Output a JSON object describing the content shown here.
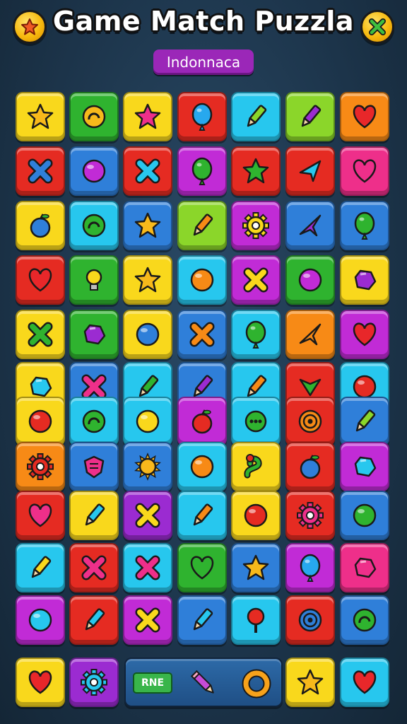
{
  "header": {
    "title": "Game Match Puzzla",
    "subtitle": "Indonnaca",
    "left_button_icon": "star-badge-icon",
    "right_button_icon": "close-icon"
  },
  "palette": {
    "yellow": "#f9d81c",
    "green": "#2fb32f",
    "red": "#e52b22",
    "cyan": "#27c7ee",
    "lime": "#8bd62a",
    "orange": "#f78a16",
    "blue": "#2f7fd9",
    "magenta": "#c12bd6",
    "pink": "#ee2f8a",
    "purple": "#9b2bd1"
  },
  "board": {
    "rows": [
      [
        [
          "yellow",
          "star"
        ],
        [
          "green",
          "swirl"
        ],
        [
          "yellow",
          "star-pink"
        ],
        [
          "red",
          "balloon"
        ],
        [
          "cyan",
          "pencil"
        ],
        [
          "lime",
          "pencil-purple"
        ],
        [
          "orange",
          "heart"
        ]
      ],
      [
        [
          "red",
          "x-blue"
        ],
        [
          "blue",
          "orb-magenta"
        ],
        [
          "red",
          "x-cyan"
        ],
        [
          "magenta",
          "balloon-green"
        ],
        [
          "red",
          "star-green"
        ],
        [
          "red",
          "arrow-cyan"
        ],
        [
          "pink",
          "heart-pink"
        ]
      ],
      [
        [
          "yellow",
          "fruit-blue"
        ],
        [
          "cyan",
          "swirl-green"
        ],
        [
          "blue",
          "star"
        ],
        [
          "lime",
          "pencil-orange"
        ],
        [
          "magenta",
          "gear-yellow"
        ],
        [
          "blue",
          "plane-purple"
        ],
        [
          "blue",
          "balloon-green"
        ]
      ],
      [
        [
          "red",
          "heart"
        ],
        [
          "green",
          "bulb"
        ],
        [
          "yellow",
          "star"
        ],
        [
          "cyan",
          "orb-orange"
        ],
        [
          "magenta",
          "x-yellow"
        ],
        [
          "green",
          "orb-magenta"
        ],
        [
          "yellow",
          "gem-purple"
        ]
      ],
      [
        [
          "yellow",
          "x-green"
        ],
        [
          "green",
          "gem-purple"
        ],
        [
          "yellow",
          "orb-blue"
        ],
        [
          "blue",
          "x-orange"
        ],
        [
          "cyan",
          "balloon-green"
        ],
        [
          "orange",
          "plane-orange"
        ],
        [
          "magenta",
          "heart"
        ]
      ],
      [
        [
          "yellow",
          "gem-cyan"
        ],
        [
          "blue",
          "x-pink"
        ],
        [
          "cyan",
          "pencil-green"
        ],
        [
          "blue",
          "pencil-purple"
        ],
        [
          "cyan",
          "pencil-orange"
        ],
        [
          "red",
          "check-green"
        ],
        [
          "cyan",
          "orb-red"
        ]
      ],
      [
        [
          "yellow",
          "orb-red"
        ],
        [
          "cyan",
          "swirl-green"
        ],
        [
          "cyan",
          "orb-yellow"
        ],
        [
          "magenta",
          "fruit-red"
        ],
        [
          "cyan",
          "dots-green"
        ],
        [
          "red",
          "target-orange"
        ],
        [
          "blue",
          "pencil-lime"
        ]
      ],
      [
        [
          "orange",
          "gear-red"
        ],
        [
          "blue",
          "shield-pink"
        ],
        [
          "blue",
          "sun"
        ],
        [
          "cyan",
          "orb-orange"
        ],
        [
          "yellow",
          "worm"
        ],
        [
          "red",
          "fruit-blue"
        ],
        [
          "magenta",
          "gem-cyan"
        ]
      ],
      [
        [
          "red",
          "heart-pink"
        ],
        [
          "yellow",
          "pencil-cyan"
        ],
        [
          "purple",
          "x-yellow"
        ],
        [
          "cyan",
          "pencil-orange"
        ],
        [
          "yellow",
          "orb-red"
        ],
        [
          "red",
          "gear-pink"
        ],
        [
          "blue",
          "orb-green"
        ]
      ],
      [
        [
          "cyan",
          "pencil-yellow"
        ],
        [
          "red",
          "x-pink"
        ],
        [
          "cyan",
          "x-pink"
        ],
        [
          "green",
          "heart-green"
        ],
        [
          "blue",
          "star"
        ],
        [
          "magenta",
          "balloon"
        ],
        [
          "pink",
          "gem-pink"
        ]
      ],
      [
        [
          "magenta",
          "orb-cyan"
        ],
        [
          "red",
          "pencil-cyan"
        ],
        [
          "magenta",
          "x-yellow"
        ],
        [
          "blue",
          "pencil-cyan"
        ],
        [
          "cyan",
          "pin-red"
        ],
        [
          "red",
          "target-blue"
        ],
        [
          "blue",
          "swirl-green"
        ]
      ]
    ],
    "bottom_row": [
      [
        "yellow",
        "heart"
      ],
      [
        "purple",
        "gear-cyan"
      ],
      [
        "yellow",
        "star"
      ],
      [
        "cyan",
        "heart"
      ]
    ]
  },
  "bottom_bar": {
    "move_label": "RNE",
    "pencil_icon": "pencil-icon",
    "ring_icon": "ring-icon"
  }
}
